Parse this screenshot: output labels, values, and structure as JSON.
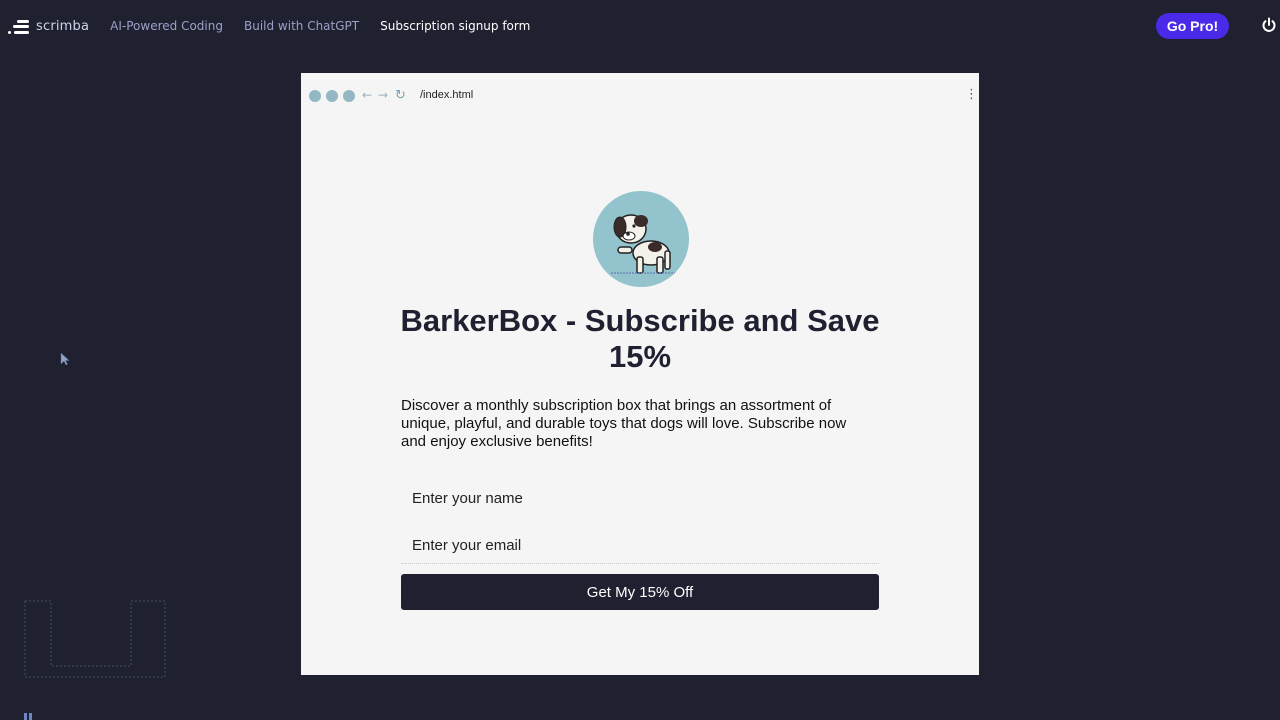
{
  "topbar": {
    "logo_text": "scrimba",
    "breadcrumbs": [
      "AI-Powered Coding",
      "Build with ChatGPT",
      "Subscription signup form"
    ],
    "go_pro_label": "Go Pro!"
  },
  "browser": {
    "url": "/index.html"
  },
  "page": {
    "avatar_icon": "dog-illustration",
    "headline": "BarkerBox - Subscribe and Save 15%",
    "description": "Discover a monthly subscription box that brings an assortment of unique, playful, and durable toys that dogs will love. Subscribe now and enjoy exclusive benefits!",
    "name_placeholder": "Enter your name",
    "email_placeholder": "Enter your email",
    "cta_label": "Get My 15% Off"
  },
  "colors": {
    "background": "#1f2130",
    "accent": "#4a2ae8",
    "page_bg": "#f5f5f5",
    "avatar_bg": "#93c3cc"
  }
}
